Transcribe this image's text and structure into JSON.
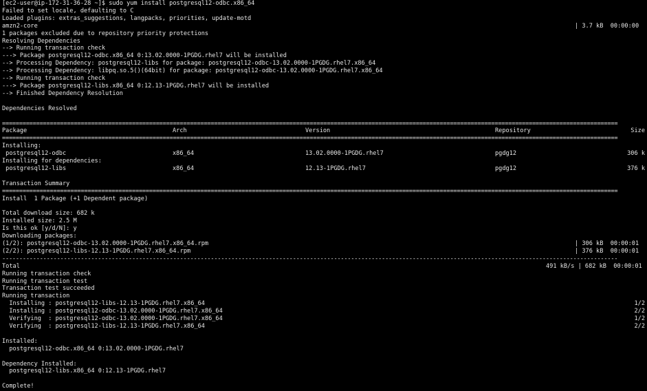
{
  "terminal": {
    "prompt": "[ec2-user@ip-172-31-36-28 ~]$ sudo yum install postgresql12-odbc.x86_64",
    "intro": [
      "Failed to set locale, defaulting to C",
      "Loaded plugins: extras_suggestions, langpacks, priorities, update-motd"
    ],
    "repo_line": {
      "name": "amzn2-core",
      "stat": "| 3.7 kB  00:00:00"
    },
    "resolve": [
      "1 packages excluded due to repository priority protections",
      "Resolving Dependencies",
      "--> Running transaction check",
      "---> Package postgresql12-odbc.x86_64 0:13.02.0000-1PGDG.rhel7 will be installed",
      "--> Processing Dependency: postgresql12-libs for package: postgresql12-odbc-13.02.0000-1PGDG.rhel7.x86_64",
      "--> Processing Dependency: libpq.so.5()(64bit) for package: postgresql12-odbc-13.02.0000-1PGDG.rhel7.x86_64",
      "--> Running transaction check",
      "---> Package postgresql12-libs.x86_64 0:12.13-1PGDG.rhel7 will be installed",
      "--> Finished Dependency Resolution"
    ],
    "deps_resolved": "Dependencies Resolved",
    "table": {
      "headers": {
        "package": "Package",
        "arch": "Arch",
        "version": "Version",
        "repository": "Repository",
        "size": "Size"
      },
      "installing_label": "Installing:",
      "installing_deps_label": "Installing for dependencies:",
      "rows": [
        {
          "package": " postgresql12-odbc",
          "arch": "x86_64",
          "version": "13.02.0000-1PGDG.rhel7",
          "repository": "pgdg12",
          "size": "306 k"
        },
        {
          "package": " postgresql12-libs",
          "arch": "x86_64",
          "version": "12.13-1PGDG.rhel7",
          "repository": "pgdg12",
          "size": "376 k"
        }
      ]
    },
    "summary_title": "Transaction Summary",
    "install_summary": "Install  1 Package (+1 Dependent package)",
    "sizes": [
      "Total download size: 682 k",
      "Installed size: 2.5 M",
      "Is this ok [y/d/N]: y",
      "Downloading packages:"
    ],
    "downloads": [
      {
        "name": "(1/2): postgresql12-odbc-13.02.0000-1PGDG.rhel7.x86_64.rpm",
        "stat": "| 306 kB  00:00:01"
      },
      {
        "name": "(2/2): postgresql12-libs-12.13-1PGDG.rhel7.x86_64.rpm",
        "stat": "| 376 kB  00:00:01"
      }
    ],
    "total": {
      "label": "Total",
      "stat": "491 kB/s | 682 kB  00:00:01"
    },
    "transaction": [
      "Running transaction check",
      "Running transaction test",
      "Transaction test succeeded",
      "Running transaction"
    ],
    "steps": [
      {
        "text": "  Installing : postgresql12-libs-12.13-1PGDG.rhel7.x86_64",
        "count": "1/2"
      },
      {
        "text": "  Installing : postgresql12-odbc-13.02.0000-1PGDG.rhel7.x86_64",
        "count": "2/2"
      },
      {
        "text": "  Verifying  : postgresql12-odbc-13.02.0000-1PGDG.rhel7.x86_64",
        "count": "1/2"
      },
      {
        "text": "  Verifying  : postgresql12-libs-12.13-1PGDG.rhel7.x86_64",
        "count": "2/2"
      }
    ],
    "installed_label": "Installed:",
    "installed_item": "  postgresql12-odbc.x86_64 0:13.02.0000-1PGDG.rhel7",
    "dep_installed_label": "Dependency Installed:",
    "dep_installed_item": "  postgresql12-libs.x86_64 0:12.13-1PGDG.rhel7",
    "complete": "Complete!",
    "rule_double": "====================================================================================================================================================================================",
    "rule_single": "------------------------------------------------------------------------------------------------------------------------------------------------------------------------------------"
  },
  "colors": {
    "background": "#000000",
    "text": "#e6e6e6"
  }
}
